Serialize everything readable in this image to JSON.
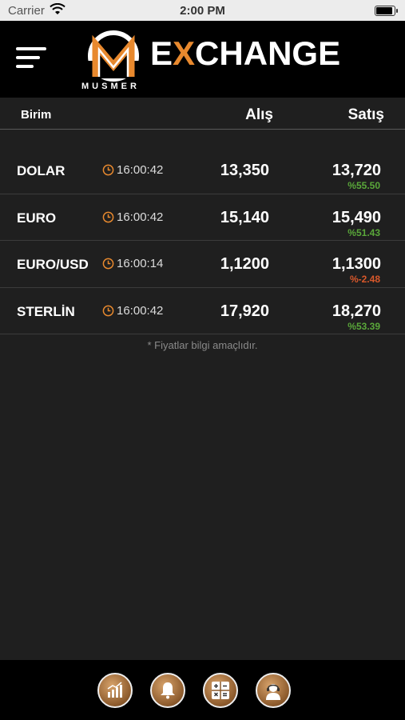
{
  "status_bar": {
    "carrier": "Carrier",
    "time": "2:00 PM"
  },
  "header": {
    "logo_text": "EXCHANGE",
    "logo_sub": "MUSMER",
    "accent_color": "#e8892e"
  },
  "table": {
    "headers": [
      "Birim",
      "Alış",
      "Satış"
    ],
    "rows": [
      {
        "name": "DOLAR",
        "time": "16:00:42",
        "buy": "13,350",
        "sell": "13,720",
        "change": "%55.50",
        "change_color": "#5aa83a"
      },
      {
        "name": "EURO",
        "time": "16:00:42",
        "buy": "15,140",
        "sell": "15,490",
        "change": "%51.43",
        "change_color": "#5aa83a"
      },
      {
        "name": "EURO/USD",
        "time": "16:00:14",
        "buy": "1,1200",
        "sell": "1,1300",
        "change": "%-2.48",
        "change_color": "#d9582b"
      },
      {
        "name": "STERLİN",
        "time": "16:00:42",
        "buy": "17,920",
        "sell": "18,270",
        "change": "%53.39",
        "change_color": "#5aa83a"
      }
    ],
    "note": "* Fiyatlar bilgi amaçlıdır."
  },
  "bottom_nav": {
    "items": [
      {
        "icon": "chart-icon"
      },
      {
        "icon": "bell-icon"
      },
      {
        "icon": "calculator-icon"
      },
      {
        "icon": "support-agent-icon"
      }
    ]
  }
}
